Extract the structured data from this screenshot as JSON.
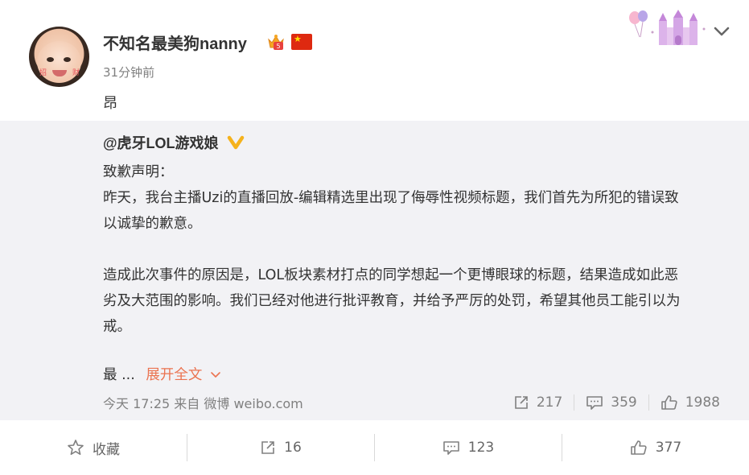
{
  "post": {
    "username": "不知名最美狗nanny",
    "time_ago": "31分钟前",
    "text": "昂",
    "avatar_tags": [
      "招",
      "财"
    ]
  },
  "repost": {
    "author": "@虎牙LOL游戏娘",
    "body_lines": [
      "致歉声明：",
      "昨天，我台主播Uzi的直播回放-编辑精选里出现了侮辱性视频标题，我们首先为所犯的错误致",
      "以诚挚的歉意。",
      "",
      "造成此次事件的原因是，LOL板块素材打点的同学想起一个更博眼球的标题，结果造成如此恶",
      "劣及大范围的影响。我们已经对他进行批评教育，并给予严厉的处罚，希望其他员工能引以为",
      "戒。"
    ],
    "truncated_prefix": "最 ...",
    "expand_label": "展开全文",
    "meta": "今天 17:25 来自 微博 weibo.com",
    "repost_count": "217",
    "comment_count": "359",
    "like_count": "1988"
  },
  "actions": {
    "favorite_label": "收藏",
    "repost_count": "16",
    "comment_count": "123",
    "like_count": "377"
  },
  "colors": {
    "accent": "#eb7350",
    "verified": "#f5b21c",
    "repost_bg": "#f2f2f5",
    "muted": "#808080"
  },
  "icons": [
    "vip-crown-icon",
    "china-flag-icon",
    "castle-badge-icon",
    "chevron-down-icon",
    "verified-v-icon",
    "repost-icon",
    "comment-icon",
    "like-icon",
    "star-icon"
  ]
}
